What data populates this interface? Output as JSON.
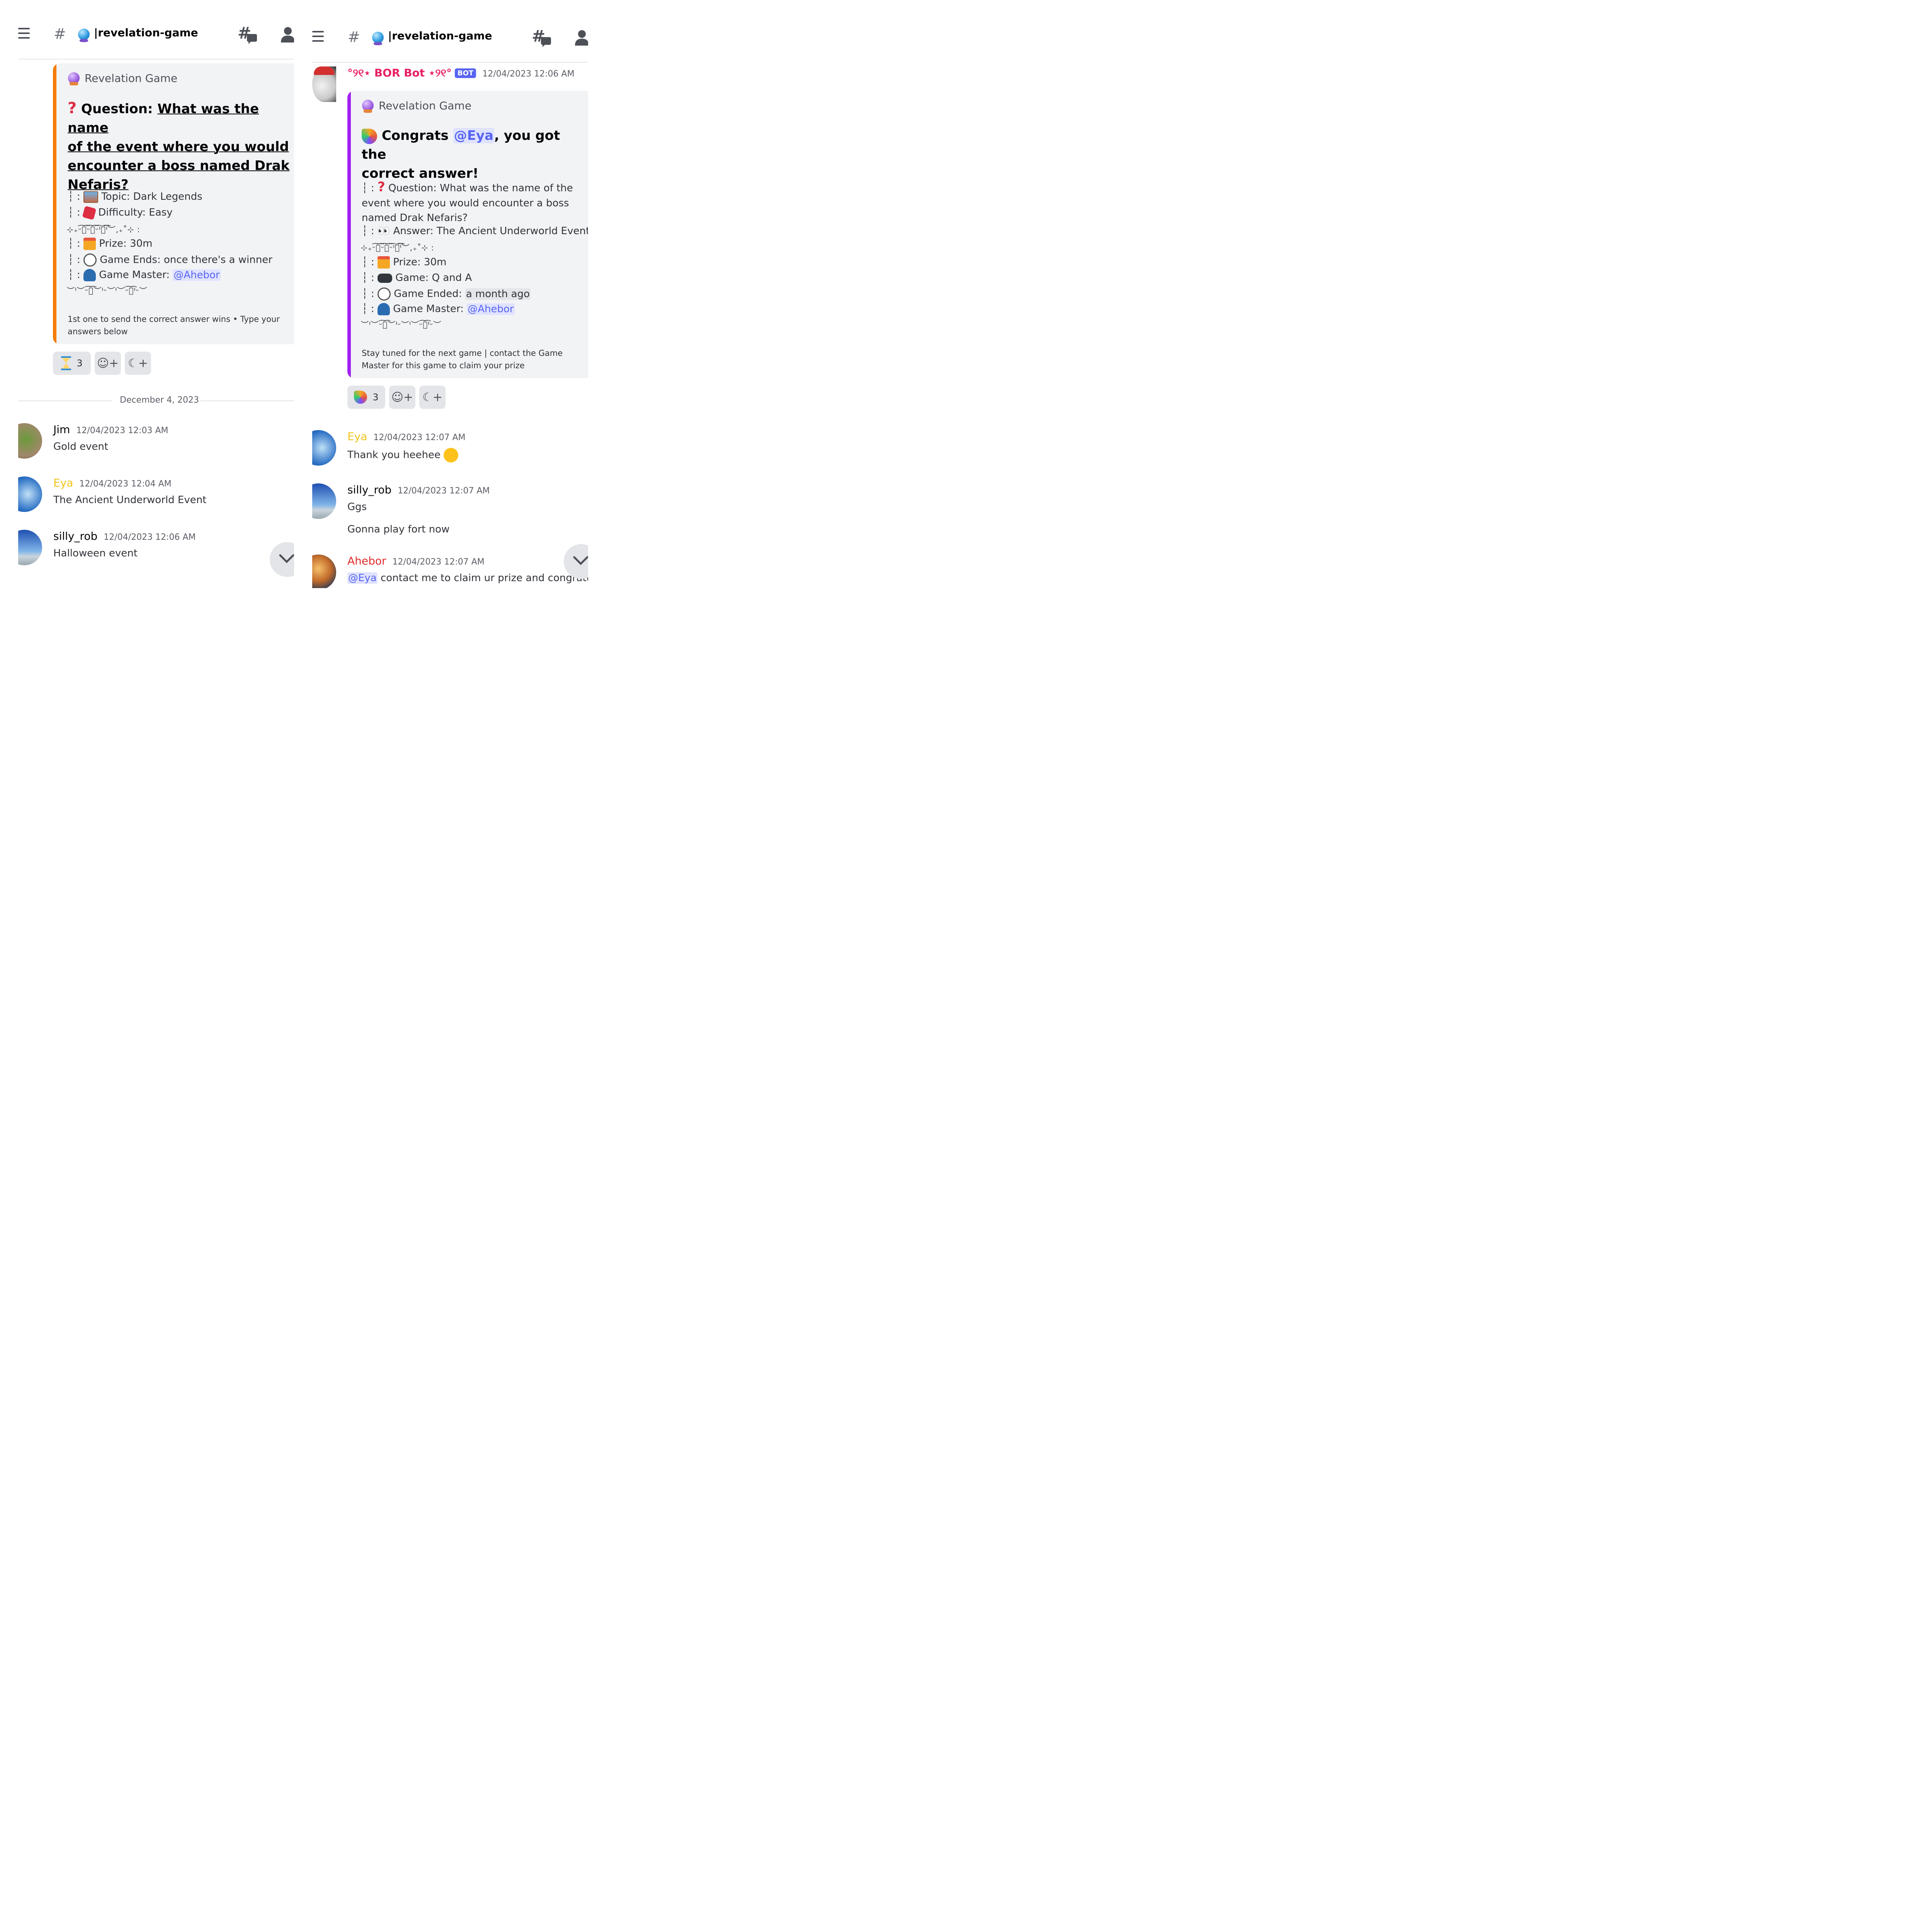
{
  "channel": {
    "name": "revelation-game"
  },
  "left": {
    "embed": {
      "author": "Revelation Game",
      "question_prefix": "Question:",
      "question_lines": [
        "What was the name",
        "of the event where you would",
        "encounter a boss named Drak",
        "Nefaris?"
      ],
      "topic": "Topic: Dark Legends",
      "difficulty": "Difficulty: Easy",
      "prize": "Prize: 30m",
      "game_ends": "Game Ends: once there's a winner",
      "game_master_label": "Game Master:",
      "game_master": "@Ahebor",
      "footer_lines": [
        "1st one to send the correct answer wins • Type your",
        "answers below"
      ],
      "deco_top": "⊹₊ᵕ͡︶͡ᵕ͡︶͡ᵕ͡ᑊ︶͡ᑊ͡︶,₊˚⊹ :",
      "deco_bottom": "︶ᑊ︶ᵕ͡︶͡︶ᑊᵕ︶ᑊ︶ᵕ͡︶͡ᑊᵕ︶"
    },
    "reactions": [
      {
        "emoji": "hourglass",
        "count": "3"
      },
      {
        "emoji": "add-reaction"
      },
      {
        "emoji": "add-super-reaction"
      }
    ],
    "date_separator": "December 4, 2023",
    "messages": [
      {
        "user": "Jim",
        "time": "12/04/2023 12:03 AM",
        "text": "Gold event",
        "color": "#060607"
      },
      {
        "user": "Eya",
        "time": "12/04/2023 12:04 AM",
        "text": "The Ancient Underworld Event",
        "color": "#f0c419"
      },
      {
        "user": "silly_rob",
        "time": "12/04/2023 12:06 AM",
        "text": "Halloween event",
        "color": "#060607"
      }
    ]
  },
  "right": {
    "bot_message": {
      "user": "°୨୧⋆ BOR Bot ⋆୨୧°",
      "badge": "BOT",
      "time": "12/04/2023 12:06 AM",
      "color": "#e91e63"
    },
    "embed": {
      "author": "Revelation Game",
      "congrats_prefix": "Congrats",
      "congrats_mention": "@Eya",
      "congrats_suffix": ", you got the",
      "congrats_line2": "correct answer!",
      "question_lines": [
        "Question: What was the name of the",
        "event where you would encounter a boss",
        "named Drak Nefaris?"
      ],
      "answer": "Answer: The Ancient Underworld Event",
      "prize": "Prize: 30m",
      "game": "Game: Q and A",
      "game_ended_label": "Game Ended:",
      "game_ended_value": "a month ago",
      "game_master_label": "Game Master:",
      "game_master": "@Ahebor",
      "footer_lines": [
        "Stay tuned for the next game | contact the Game",
        "Master for this game to claim your prize"
      ],
      "deco_top": "⊹₊ᵕ͡︶͡ᵕ͡︶͡ᵕ͡ᑊ︶͡ᑊ͡︶,₊˚⊹ :",
      "deco_bottom": "︶ᑊ︶ᵕ͡︶͡︶ᑊᵕ︶ᑊ︶ᵕ͡︶͡ᑊᵕ︶"
    },
    "reactions": [
      {
        "emoji": "party-popper",
        "count": "3"
      },
      {
        "emoji": "add-reaction"
      },
      {
        "emoji": "add-super-reaction"
      }
    ],
    "messages": [
      {
        "user": "Eya",
        "time": "12/04/2023 12:07 AM",
        "text": "Thank you heehee",
        "color": "#f0c419"
      },
      {
        "user": "silly_rob",
        "time": "12/04/2023 12:07 AM",
        "text": "Ggs",
        "text2": "Gonna play fort now",
        "color": "#060607"
      },
      {
        "user": "Ahebor",
        "time": "12/04/2023 12:07 AM",
        "mention": "@Eya",
        "text": " contact me to claim ur prize and congratulatio",
        "color": "#e02b2b"
      }
    ]
  }
}
